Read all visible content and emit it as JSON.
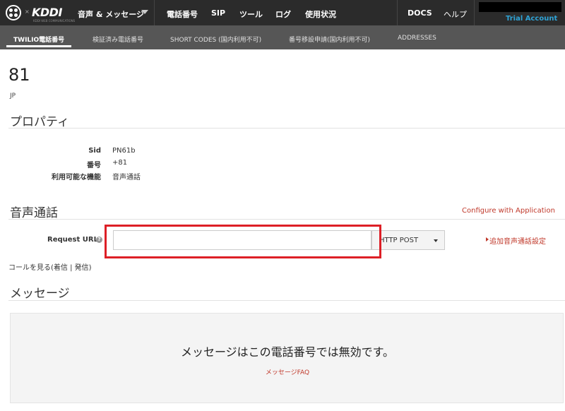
{
  "topnav": {
    "logo_text": "KDDI",
    "logo_separator": "×",
    "logo_tagline": "KDDI WEB COMMUNICATIONS",
    "product_label": "音声 & メッセージ",
    "items": [
      "電話番号",
      "SIP",
      "ツール",
      "ログ",
      "使用状況"
    ],
    "docs_label": "DOCS",
    "help_label": "ヘルプ",
    "account_label": "Trial Account"
  },
  "subnav": {
    "items": [
      "TWILIO電話番号",
      "検証済み電話番号",
      "SHORT CODES (国内利用不可)",
      "番号移設申請(国内利用不可)",
      "ADDRESSES"
    ]
  },
  "number": {
    "title": "81",
    "country": "JP"
  },
  "properties": {
    "heading": "プロパティ",
    "rows": [
      {
        "label": "Sid",
        "value": "PN61b"
      },
      {
        "label": "番号",
        "value": "+81"
      },
      {
        "label": "利用可能な機能",
        "value": "音声通話"
      }
    ]
  },
  "voice": {
    "heading": "音声通話",
    "configure_link": "Configure with Application",
    "request_url_label": "Request URL",
    "help_glyph": "?",
    "request_url_value": "",
    "method_value": "HTTP POST",
    "add_settings_link": "追加音声通話設定",
    "call_links_text": "コールを見る(着信 | 発信)"
  },
  "messaging": {
    "heading": "メッセージ",
    "disabled_text": "メッセージはこの電話番号では無効です。",
    "faq_link": "メッセージFAQ"
  },
  "colors": {
    "topnav_bg": "#2b2b2b",
    "subnav_bg": "#565656",
    "accent_link": "#c0392b",
    "trial_blue": "#2ea3d6",
    "highlight_red": "#dd1f26"
  }
}
